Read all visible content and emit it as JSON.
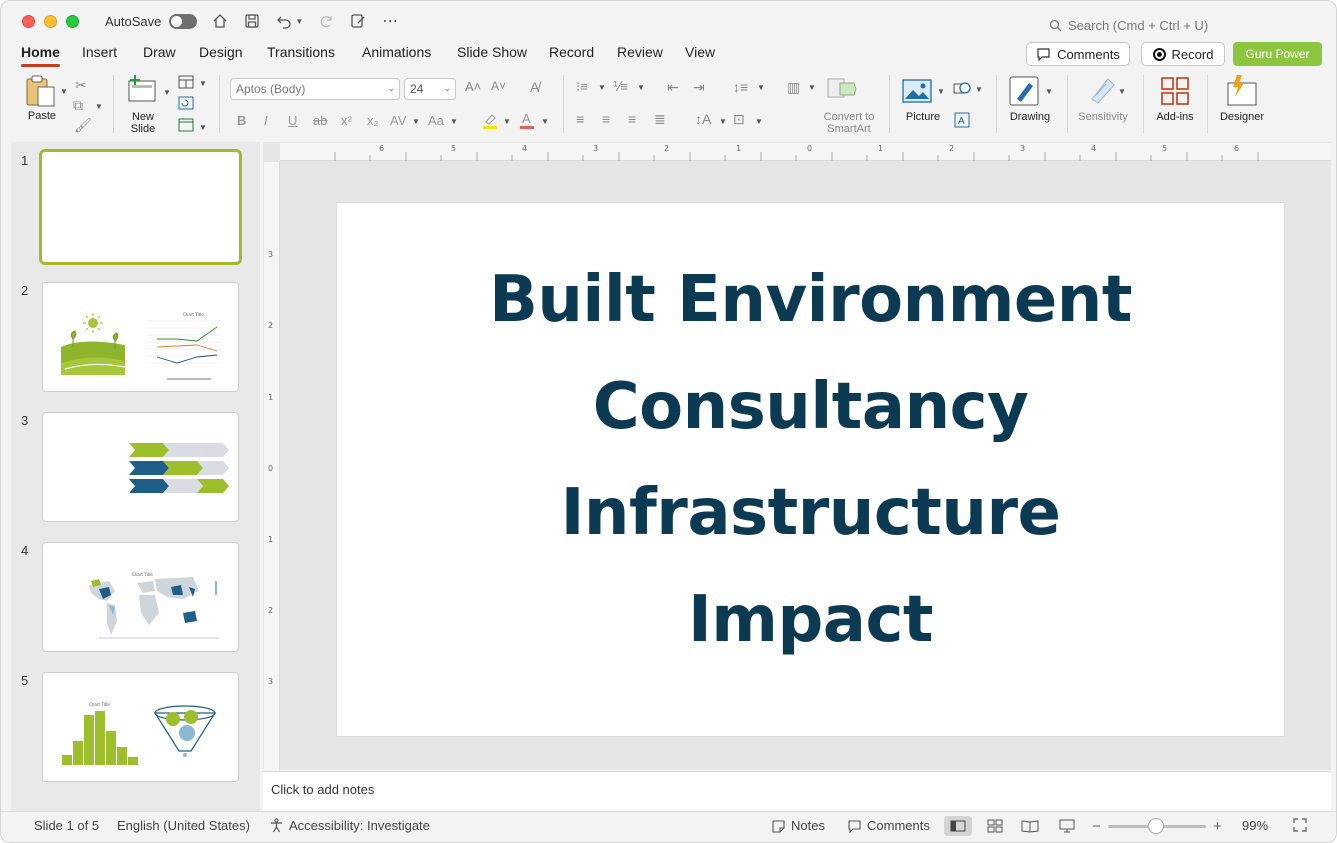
{
  "titlebar": {
    "autosave_label": "AutoSave",
    "search_placeholder": "Search (Cmd + Ctrl + U)"
  },
  "tabs": [
    "Home",
    "Insert",
    "Draw",
    "Design",
    "Transitions",
    "Animations",
    "Slide Show",
    "Record",
    "Review",
    "View"
  ],
  "active_tab": "Home",
  "header_buttons": {
    "comments": "Comments",
    "record": "Record",
    "guru": "Guru Power"
  },
  "ribbon": {
    "paste": "Paste",
    "new_slide": "New\nSlide",
    "font_name": "Aptos (Body)",
    "font_size": "24",
    "convert_smartart": "Convert to\nSmartArt",
    "picture": "Picture",
    "drawing": "Drawing",
    "sensitivity": "Sensitivity",
    "addins": "Add-ins",
    "designer": "Designer"
  },
  "slides": [
    {
      "number": "1",
      "selected": true
    },
    {
      "number": "2",
      "selected": false
    },
    {
      "number": "3",
      "selected": false
    },
    {
      "number": "4",
      "selected": false
    },
    {
      "number": "5",
      "selected": false
    }
  ],
  "thumb_texts": {
    "chart_title": "Chart Title"
  },
  "slide_title_lines": [
    "Built Environment",
    "Consultancy",
    "Infrastructure",
    "Impact"
  ],
  "notes_placeholder": "Click to add notes",
  "ruler": {
    "h_numbers": [
      "6",
      "5",
      "4",
      "3",
      "2",
      "1",
      "0",
      "1",
      "2",
      "3",
      "4",
      "5",
      "6"
    ],
    "v_numbers": [
      "3",
      "2",
      "1",
      "0",
      "1",
      "2",
      "3"
    ]
  },
  "statusbar": {
    "slide_info": "Slide 1 of 5",
    "language": "English (United States)",
    "accessibility": "Accessibility: Investigate",
    "notes": "Notes",
    "comments": "Comments",
    "zoom": "99%"
  },
  "colors": {
    "accent_tab": "#c43e1c",
    "title_text": "#0b3a52",
    "selected_thumb": "#a6b92d",
    "guru_button": "#8cc63f"
  }
}
